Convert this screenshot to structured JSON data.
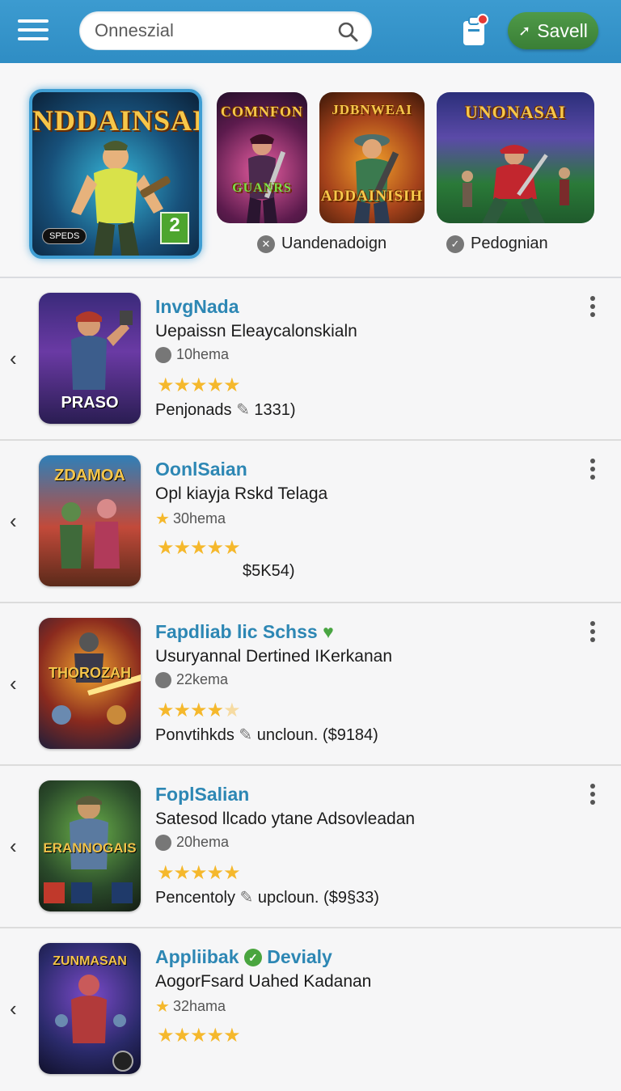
{
  "header": {
    "search_placeholder": "Onneszial",
    "save_label": "Savell"
  },
  "featured": {
    "main_title": "NDDAINSAI",
    "main_badge": "2",
    "main_pill": "SPEDS",
    "tiles": [
      {
        "title": "COMNFON",
        "sub": "GUANRS"
      },
      {
        "title": "JDBNWEAI",
        "sub": "ADDAINISIH"
      },
      {
        "title": "UNONASAI",
        "sub": ""
      }
    ],
    "categories": [
      {
        "label": "Uandenadoign"
      },
      {
        "label": "Pedognian"
      }
    ]
  },
  "list": [
    {
      "name": "InvgNada",
      "subtitle": "Uepaissn Eleaycalonskialn",
      "meta": "10hema",
      "rating": 5,
      "price": "Penjonads",
      "size": "1331)",
      "thumb_label": "PRASO"
    },
    {
      "name": "OonlSaian",
      "subtitle": "Opl kiayja Rskd Telaga",
      "meta": "30hema",
      "rating": 5,
      "price": "",
      "size": "$5K54)",
      "thumb_label": "ZDAMOA"
    },
    {
      "name": "Fapdliab lic Schss",
      "subtitle": "Usuryannal Dertined IKerkanan",
      "meta": "22kema",
      "rating": 4,
      "price": "Ponvtihkds",
      "size": "uncloun. ($9184)",
      "thumb_label": "THOROZAH"
    },
    {
      "name": "FoplSalian",
      "subtitle": "Satesod llcado ytane Adsovleadan",
      "meta": "20hema",
      "rating": 5,
      "price": "Pencentoly",
      "size": "upcloun. ($9§33)",
      "thumb_label": "ERANNOGAIS"
    },
    {
      "name": "Appliibak",
      "name_suffix": "Devialy",
      "subtitle": "AogorFsard Uahed Kadanan",
      "meta": "32hama",
      "rating": 5,
      "price": "",
      "size": "",
      "thumb_label": "ZUNMASAN"
    }
  ],
  "colors": {
    "header": "#3c9bd0",
    "accent_green": "#4f9a48",
    "title_blue": "#2d87b4",
    "star": "#f5b82c"
  }
}
